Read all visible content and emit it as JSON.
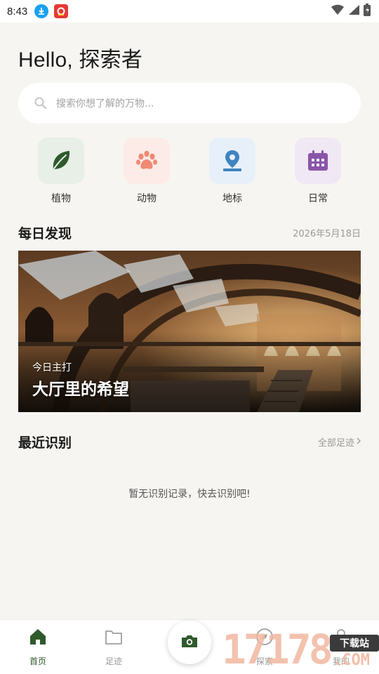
{
  "status_bar": {
    "time": "8:43"
  },
  "greeting": "Hello, 探索者",
  "search": {
    "placeholder": "搜索你想了解的万物..."
  },
  "categories": [
    {
      "label": "植物",
      "icon": "leaf-icon",
      "bg": "#e7efe6",
      "color": "#2f5a2c"
    },
    {
      "label": "动物",
      "icon": "paw-icon",
      "bg": "#fcebe6",
      "color": "#ef8a74"
    },
    {
      "label": "地标",
      "icon": "map-pin-icon",
      "bg": "#e7f0f8",
      "color": "#3f84c0"
    },
    {
      "label": "日常",
      "icon": "calendar-icon",
      "bg": "#f0e8f4",
      "color": "#8a55a8"
    }
  ],
  "daily": {
    "title": "每日发现",
    "date": "2026年5月18日",
    "kicker": "今日主打",
    "headline": "大厅里的希望"
  },
  "recent": {
    "title": "最近识别",
    "link": "全部足迹",
    "empty_text": "暂无识别记录，快去识别吧!"
  },
  "bottom_nav": [
    {
      "label": "首页",
      "icon": "home-icon",
      "active": true
    },
    {
      "label": "足迹",
      "icon": "folder-icon",
      "active": false
    },
    {
      "label": "探索",
      "icon": "compass-icon",
      "active": false
    },
    {
      "label": "我的",
      "icon": "person-icon",
      "active": false
    }
  ],
  "watermark": {
    "number": "17178",
    "box": "下载站",
    "suffix": ".COM"
  },
  "colors": {
    "accent": "#2f5a2c",
    "background": "#f7f5f1"
  }
}
